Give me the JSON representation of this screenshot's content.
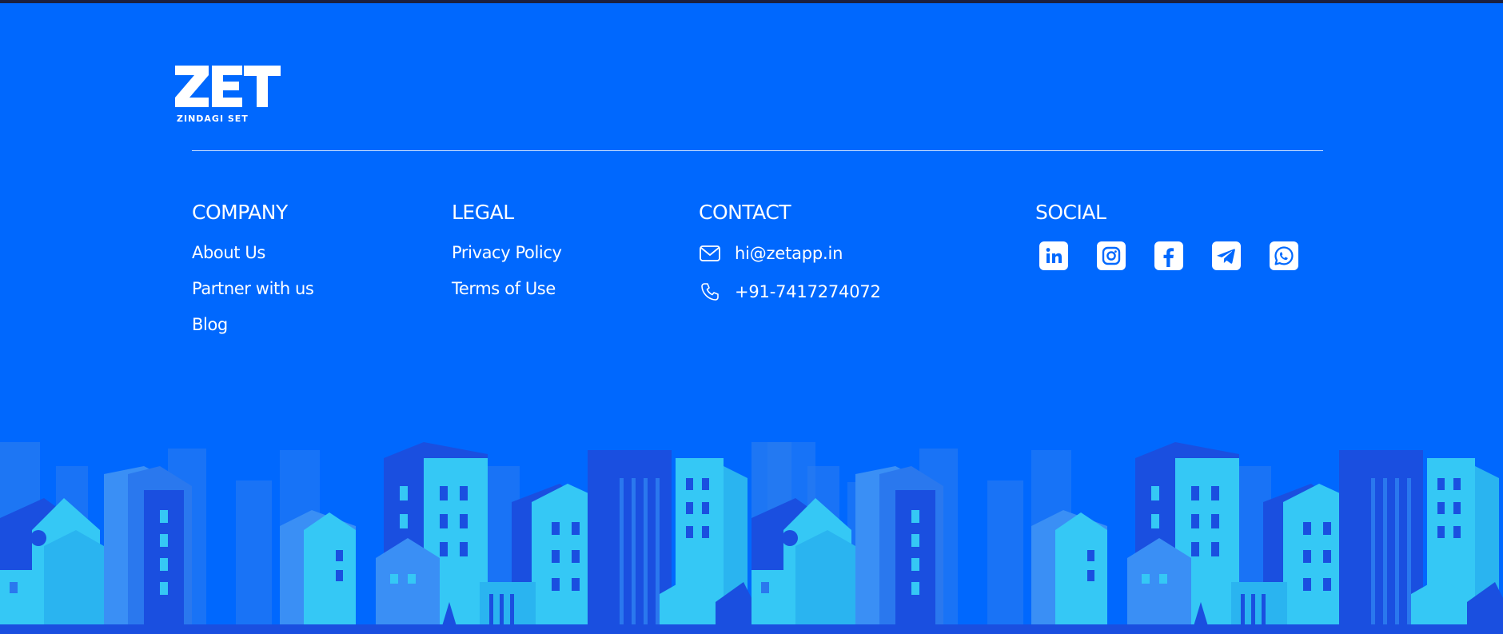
{
  "brand": {
    "logo_word": "ZET",
    "tagline": "ZINDAGI SET"
  },
  "columns": {
    "company": {
      "title": "COMPANY",
      "links": [
        "About Us",
        "Partner with us",
        "Blog"
      ]
    },
    "legal": {
      "title": "LEGAL",
      "links": [
        "Privacy Policy",
        "Terms of Use"
      ]
    },
    "contact": {
      "title": "CONTACT",
      "email": "hi@zetapp.in",
      "phone": "+91-7417274072"
    },
    "social": {
      "title": "SOCIAL",
      "icons": [
        "linkedin-icon",
        "instagram-icon",
        "facebook-icon",
        "telegram-icon",
        "whatsapp-icon"
      ]
    }
  },
  "colors": {
    "background": "#0068fe",
    "text": "#ffffff",
    "city_light": "#35c8f5",
    "city_mid": "#2a8af0",
    "city_dark": "#1240d8"
  }
}
